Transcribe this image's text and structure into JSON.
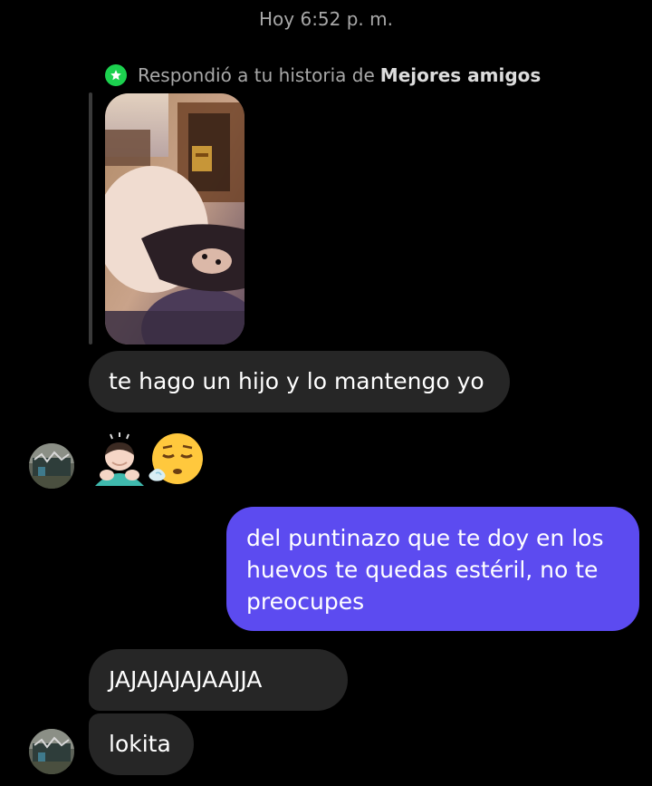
{
  "header": {
    "timestamp": "Hoy 6:52 p. m."
  },
  "story_reply": {
    "note_prefix": "Respondió a tu historia de",
    "note_audience": "Mejores amigos",
    "badge_icon": "star-icon",
    "badge_color": "#1cd14f"
  },
  "messages": [
    {
      "sender": "them",
      "text": "te hago un hijo y lo mantengo yo"
    },
    {
      "sender": "them",
      "type": "emoji",
      "text": "🙇🏻‍♂️😮‍💨",
      "icons": [
        "person-bowing-icon",
        "face-exhaling-icon"
      ]
    },
    {
      "sender": "me",
      "text": "del puntinazo que te doy en los huevos te quedas estéril, no te preocupes"
    },
    {
      "sender": "them",
      "text": "JAJAJAJAJAAJJA"
    },
    {
      "sender": "them",
      "text": "lokita"
    }
  ],
  "colors": {
    "background": "#000000",
    "incoming_bubble": "#262626",
    "outgoing_bubble": "#5c4bf0",
    "meta_text": "#a8a8a8"
  }
}
